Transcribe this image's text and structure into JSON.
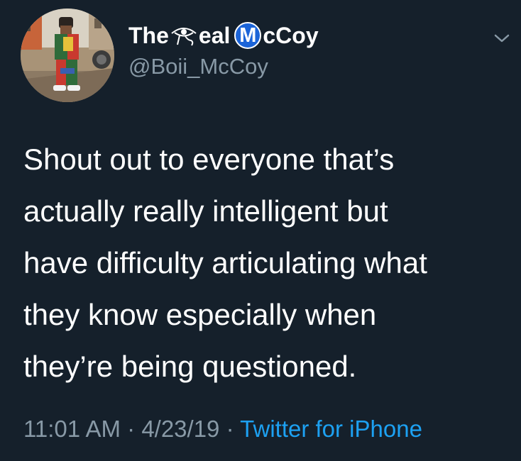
{
  "tweet": {
    "display_name_prefix": "The",
    "display_name_mid": "eal",
    "display_name_badge": "M",
    "display_name_suffix": "cCoy",
    "handle": "@Boii_McCoy",
    "text": "Shout out to everyone that’s\nactually really intelligent but\nhave difficulty articulating what\nthey know especially when\nthey’re being questioned.",
    "time": "11:01 AM",
    "separator1": " · ",
    "date": "4/23/19",
    "separator2": " · ",
    "source": "Twitter for iPhone"
  },
  "icons": {
    "avatar": "profile-photo",
    "eye": "eye-of-ra-icon",
    "chevron": "chevron-down-icon"
  },
  "colors": {
    "background": "#15202b",
    "text": "#ffffff",
    "secondary": "#8899a6",
    "link": "#1da1f2",
    "badge": "#1b64d8"
  }
}
